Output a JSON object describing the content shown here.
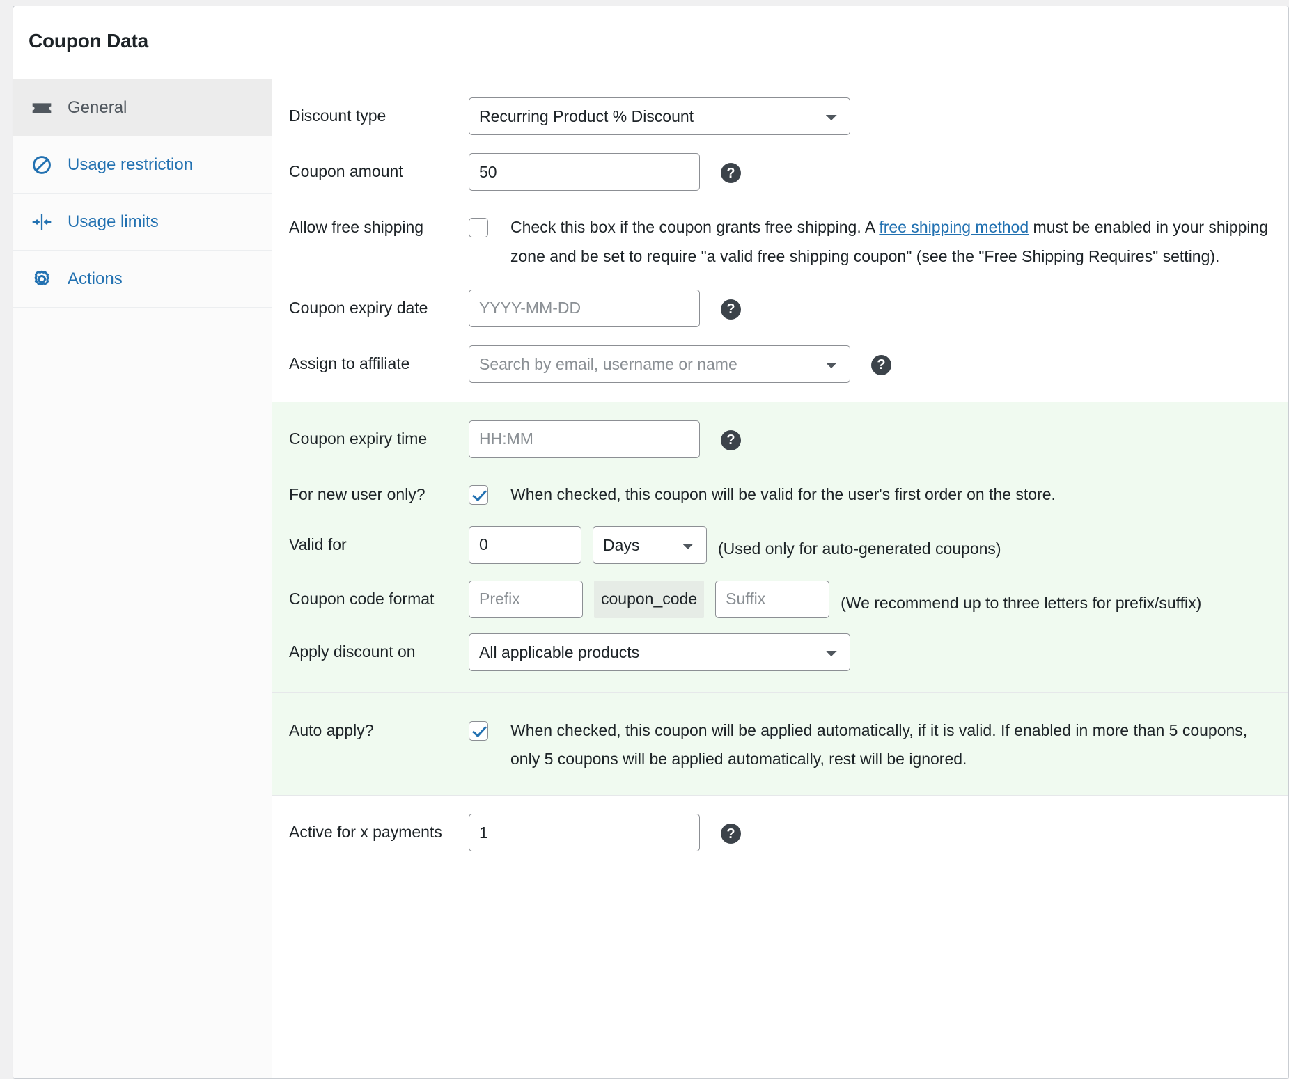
{
  "panel": {
    "title": "Coupon Data"
  },
  "sidebar": {
    "items": [
      {
        "label": "General",
        "icon": "ticket-icon",
        "active": true
      },
      {
        "label": "Usage restriction",
        "icon": "block-icon",
        "active": false
      },
      {
        "label": "Usage limits",
        "icon": "limits-icon",
        "active": false
      },
      {
        "label": "Actions",
        "icon": "gear-icon",
        "active": false
      }
    ]
  },
  "form": {
    "discount_type": {
      "label": "Discount type",
      "value": "Recurring Product % Discount",
      "options": [
        "Recurring Product % Discount"
      ]
    },
    "coupon_amount": {
      "label": "Coupon amount",
      "value": "50",
      "help": "?"
    },
    "free_shipping": {
      "label": "Allow free shipping",
      "checked": false,
      "text_before": "Check this box if the coupon grants free shipping. A ",
      "link": "free shipping method",
      "text_after": " must be enabled in your shipping zone and be set to require \"a valid free shipping coupon\" (see the \"Free Shipping Requires\" setting)."
    },
    "expiry_date": {
      "label": "Coupon expiry date",
      "value": "",
      "placeholder": "YYYY-MM-DD",
      "help": "?"
    },
    "assign_affiliate": {
      "label": "Assign to affiliate",
      "value": "Search by email, username or name",
      "help": "?"
    },
    "expiry_time": {
      "label": "Coupon expiry time",
      "value": "",
      "placeholder": "HH:MM",
      "help": "?"
    },
    "new_user_only": {
      "label": "For new user only?",
      "checked": true,
      "text": "When checked, this coupon will be valid for the user's first order on the store."
    },
    "valid_for": {
      "label": "Valid for",
      "value": "0",
      "unit": "Days",
      "unit_options": [
        "Days"
      ],
      "note": "(Used only for auto-generated coupons)"
    },
    "code_format": {
      "label": "Coupon code format",
      "prefix_placeholder": "Prefix",
      "prefix_value": "",
      "chip": "coupon_code",
      "suffix_placeholder": "Suffix",
      "suffix_value": "",
      "note": "(We recommend up to three letters for prefix/suffix)"
    },
    "apply_discount_on": {
      "label": "Apply discount on",
      "value": "All applicable products",
      "options": [
        "All applicable products"
      ]
    },
    "auto_apply": {
      "label": "Auto apply?",
      "checked": true,
      "text": "When checked, this coupon will be applied automatically, if it is valid. If enabled in more than 5 coupons, only 5 coupons will be applied automatically, rest will be ignored."
    },
    "active_payments": {
      "label": "Active for x payments",
      "value": "1",
      "help": "?"
    }
  },
  "colors": {
    "link": "#2271b1",
    "highlight_section": "#f0faf0",
    "active_sidebar": "#ececec"
  }
}
